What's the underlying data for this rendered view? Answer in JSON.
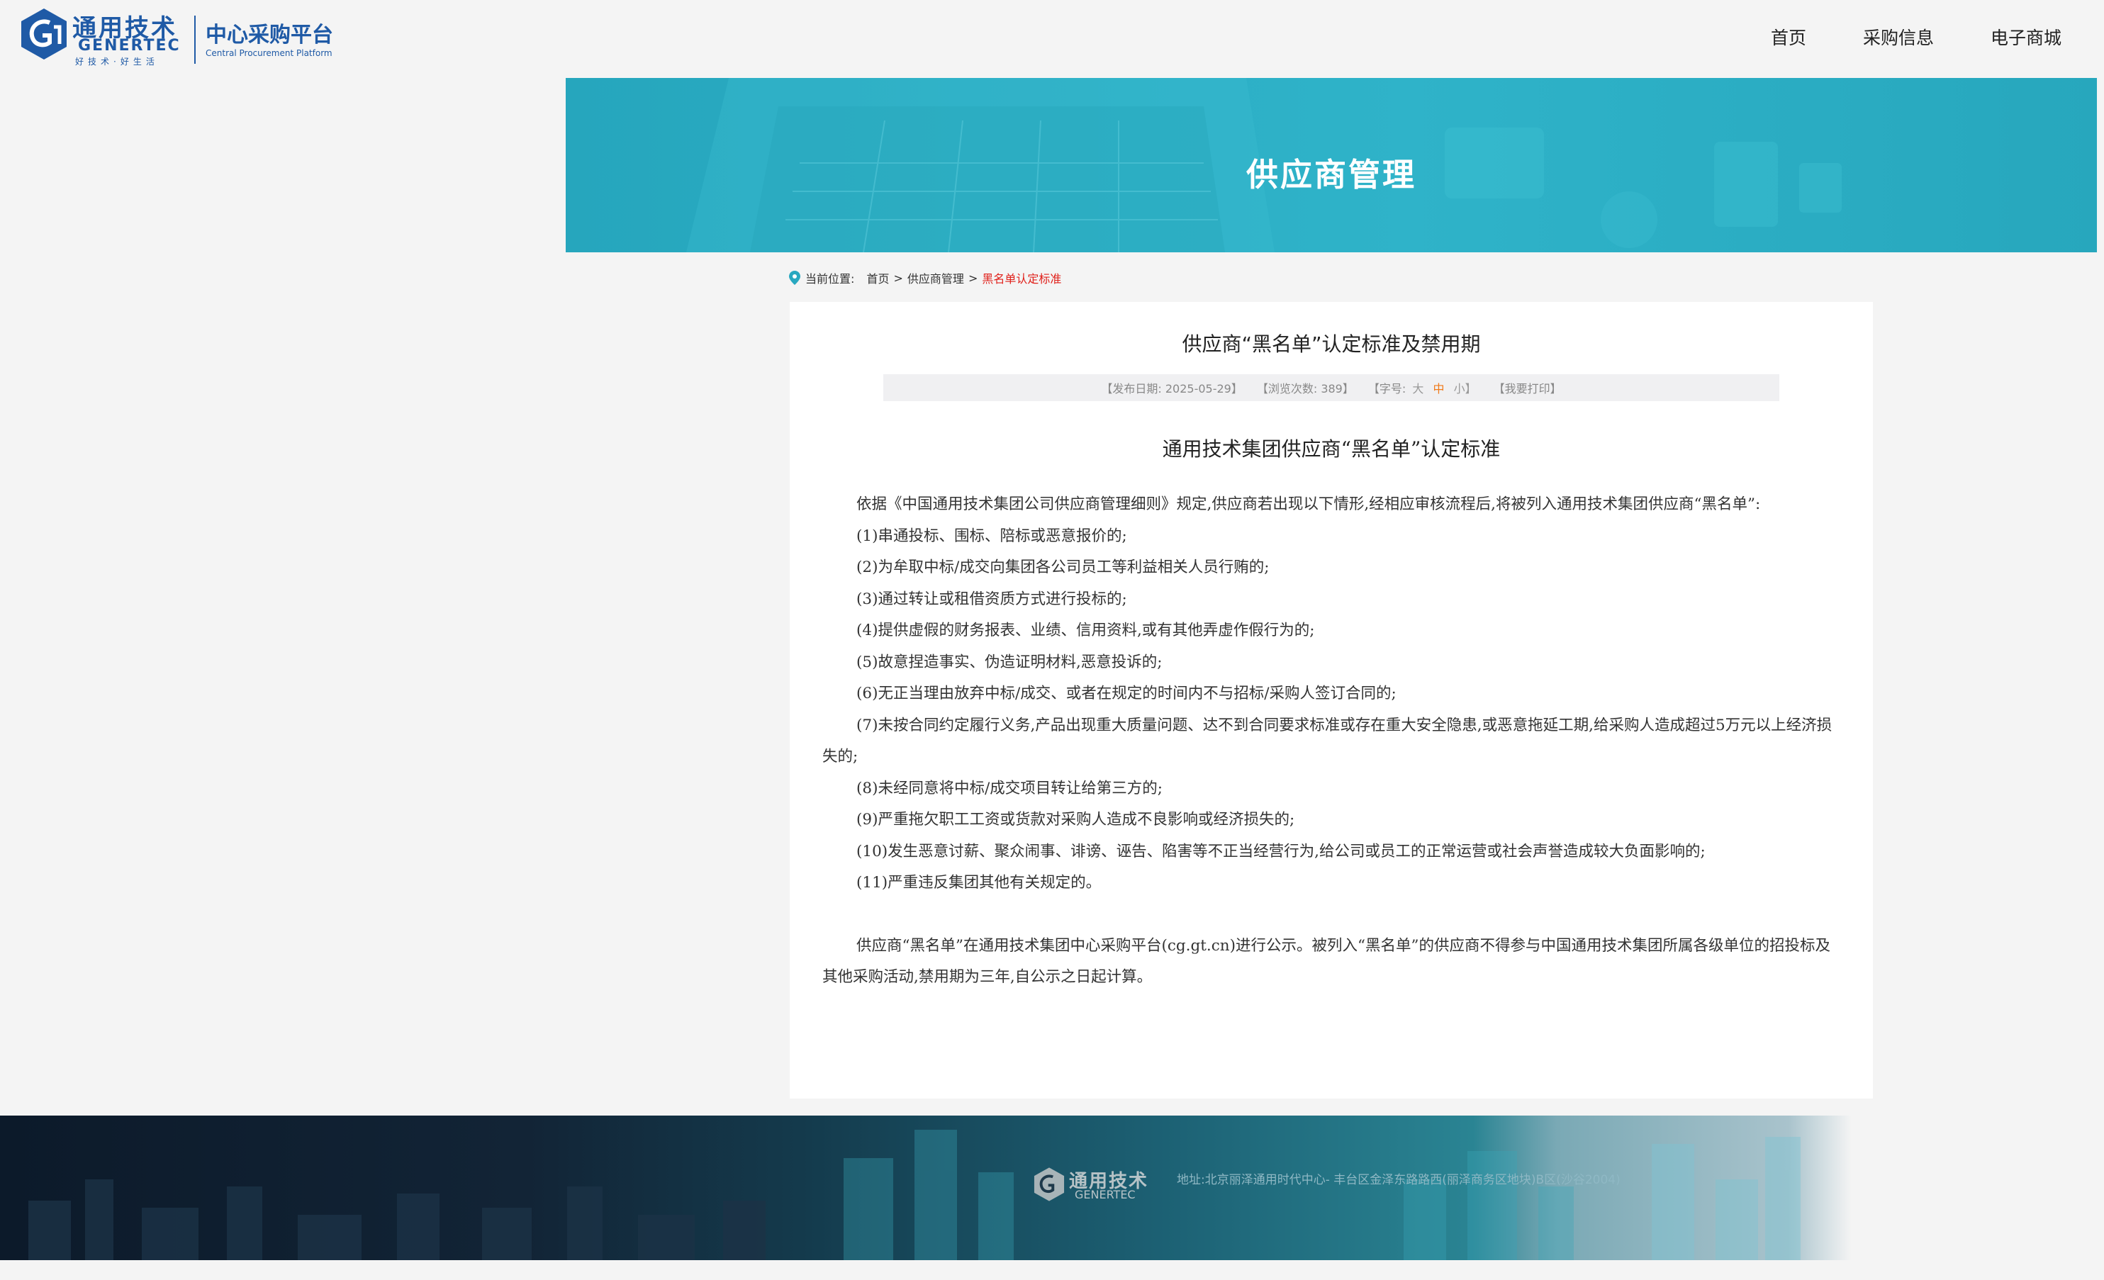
{
  "header": {
    "logo_cn": "通用技术",
    "logo_en": "GENERTEC",
    "logo_slogan": "好技术·好生活",
    "platform_cn": "中心采购平台",
    "platform_en": "Central Procurement Platform",
    "nav": [
      "首页",
      "采购信息",
      "电子商城"
    ]
  },
  "banner": {
    "title": "供应商管理"
  },
  "breadcrumb": {
    "prefix": "当前位置:",
    "items": [
      "首页",
      "供应商管理"
    ],
    "separator": ">",
    "current": "黑名单认定标准"
  },
  "article": {
    "title": "供应商“黑名单”认定标准及禁用期",
    "meta": {
      "date_label": "【发布日期:  2025-05-29】",
      "views_label": "【浏览次数:   389】",
      "font_open": "【字号:",
      "font_large": "大",
      "font_medium": "中",
      "font_small": "小】",
      "print": "【我要打印】"
    },
    "subtitle": "通用技术集团供应商“黑名单”认定标准",
    "intro": "依据《中国通用技术集团公司供应商管理细则》规定,供应商若出现以下情形,经相应审核流程后,将被列入通用技术集团供应商“黑名单”:",
    "items": [
      "(1)串通投标、围标、陪标或恶意报价的;",
      "(2)为牟取中标/成交向集团各公司员工等利益相关人员行贿的;",
      "(3)通过转让或租借资质方式进行投标的;",
      "(4)提供虚假的财务报表、业绩、信用资料,或有其他弄虚作假行为的;",
      "(5)故意捏造事实、伪造证明材料,恶意投诉的;",
      "(6)无正当理由放弃中标/成交、或者在规定的时间内不与招标/采购人签订合同的;",
      "(7)未按合同约定履行义务,产品出现重大质量问题、达不到合同要求标准或存在重大安全隐患,或恶意拖延工期,给采购人造成超过5万元以上经济损失的;",
      "(8)未经同意将中标/成交项目转让给第三方的;",
      "(9)严重拖欠职工工资或货款对采购人造成不良影响或经济损失的;",
      "(10)发生恶意讨薪、聚众闹事、诽谤、诬告、陷害等不正当经营行为,给公司或员工的正常运营或社会声誉造成较大负面影响的;",
      "(11)严重违反集团其他有关规定的。"
    ],
    "closing": "供应商“黑名单”在通用技术集团中心采购平台(cg.gt.cn)进行公示。被列入“黑名单”的供应商不得参与中国通用技术集团所属各级单位的招投标及其他采购活动,禁用期为三年,自公示之日起计算。"
  },
  "footer": {
    "logo_cn": "通用技术",
    "logo_en": "GENERTEC",
    "address": "地址:北京丽泽通用时代中心- 丰台区金泽东路路西(丽泽商务区地块)B区(沙谷2004)"
  },
  "colors": {
    "brand_blue": "#1f5aa6",
    "banner_teal": "#2fb3c9",
    "breadcrumb_current": "#e0201a",
    "font_medium_active": "#f07a1a"
  },
  "icons": [
    "location-pin-icon",
    "genertec-logo-icon"
  ]
}
